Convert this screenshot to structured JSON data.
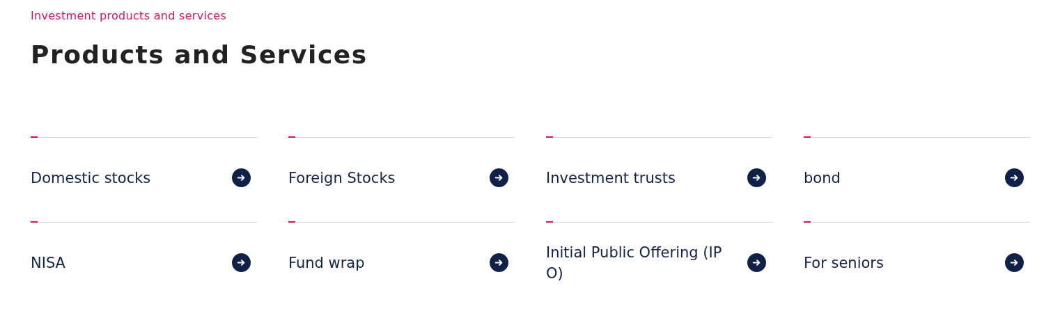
{
  "eyebrow": "Investment products and services",
  "heading": "Products and Services",
  "items": [
    {
      "label": "Domestic stocks"
    },
    {
      "label": "Foreign Stocks"
    },
    {
      "label": "Investment trusts"
    },
    {
      "label": "bond"
    },
    {
      "label": "NISA"
    },
    {
      "label": "Fund wrap"
    },
    {
      "label": "Initial Public Offering (IPO)"
    },
    {
      "label": "For seniors"
    }
  ]
}
